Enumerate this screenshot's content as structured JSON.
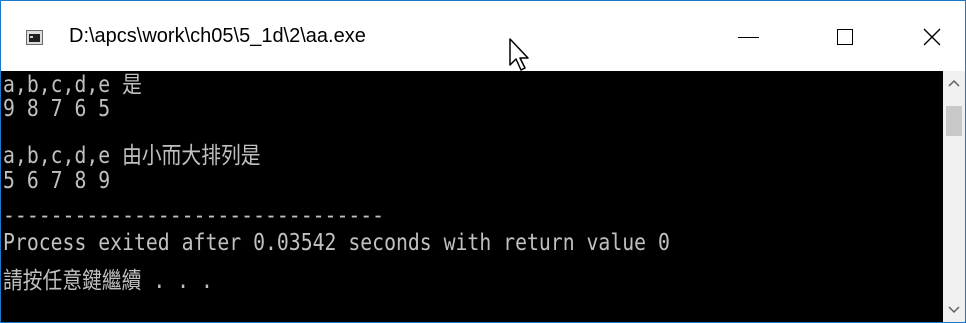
{
  "window": {
    "title": "D:\\apcs\\work\\ch05\\5_1d\\2\\aa.exe",
    "icon": "console-app-icon",
    "controls": {
      "minimize": "minimize-icon",
      "maximize": "maximize-icon",
      "close": "close-icon"
    }
  },
  "console": {
    "lines": [
      "a,b,c,d,e 是",
      "9 8 7 6 5",
      "a,b,c,d,e 由小而大排列是",
      "5 6 7 8 9",
      "",
      "--------------------------------",
      "Process exited after 0.03542 seconds with return value 0",
      "請按任意鍵繼續 . . ."
    ],
    "text_color": "#c0c0c0",
    "background": "#000000"
  },
  "scrollbar": {
    "up": "scroll-up-icon",
    "down": "scroll-down-icon"
  },
  "colors": {
    "window_border": "#1979ca",
    "titlebar_bg": "#ffffff",
    "scrollbar_bg": "#f0f0f0"
  }
}
